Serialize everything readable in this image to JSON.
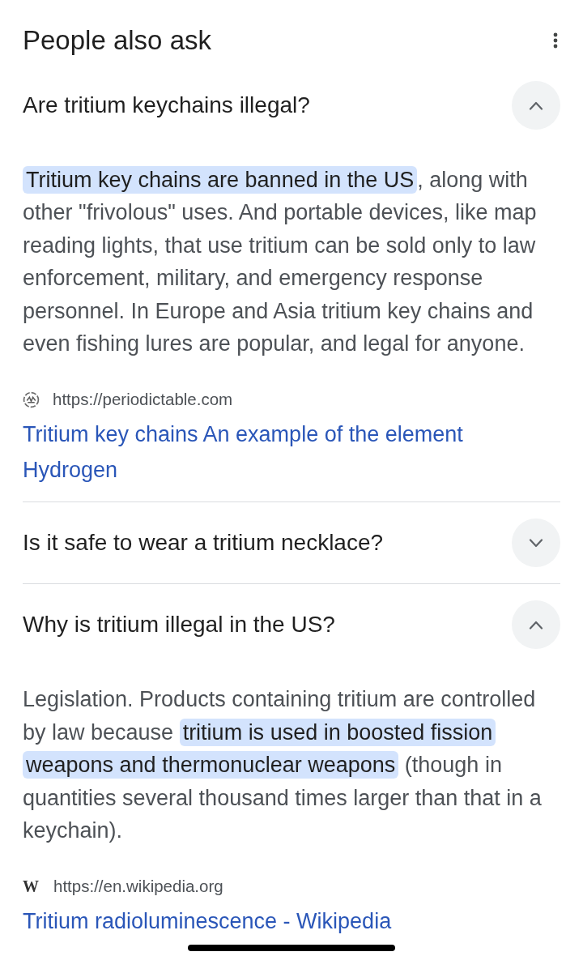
{
  "header": {
    "title": "People also ask"
  },
  "questions": [
    {
      "question": "Are tritium keychains illegal?",
      "expanded": true,
      "answer": [
        {
          "text": "Tritium key chains are banned in the US",
          "highlighted": true
        },
        {
          "text": ", along with other \"frivolous\" uses. And portable devices, like map reading lights, that use tritium can be sold only to law enforcement, military, and emergency response personnel. In Europe and Asia tritium key chains and even fishing lures are popular, and legal for anyone.",
          "highlighted": false
        }
      ],
      "source": {
        "favicon": {
          "kind": "logo"
        },
        "url": "https://periodictable.com",
        "title": "Tritium key chains An example of the element Hydrogen"
      }
    },
    {
      "question": "Is it safe to wear a tritium necklace?",
      "expanded": false
    },
    {
      "question": "Why is tritium illegal in the US?",
      "expanded": true,
      "answer": [
        {
          "text": "Legislation. Products containing tritium are controlled by law because ",
          "highlighted": false
        },
        {
          "text": "tritium is used in boosted fission weapons and thermonuclear weapons",
          "highlighted": true
        },
        {
          "text": " (though in quantities several thousand times larger than that in a keychain).",
          "highlighted": false
        }
      ],
      "source": {
        "favicon": {
          "kind": "letter",
          "letter": "W"
        },
        "url": "https://en.wikipedia.org",
        "title": "Tritium radioluminescence - Wikipedia"
      }
    }
  ]
}
